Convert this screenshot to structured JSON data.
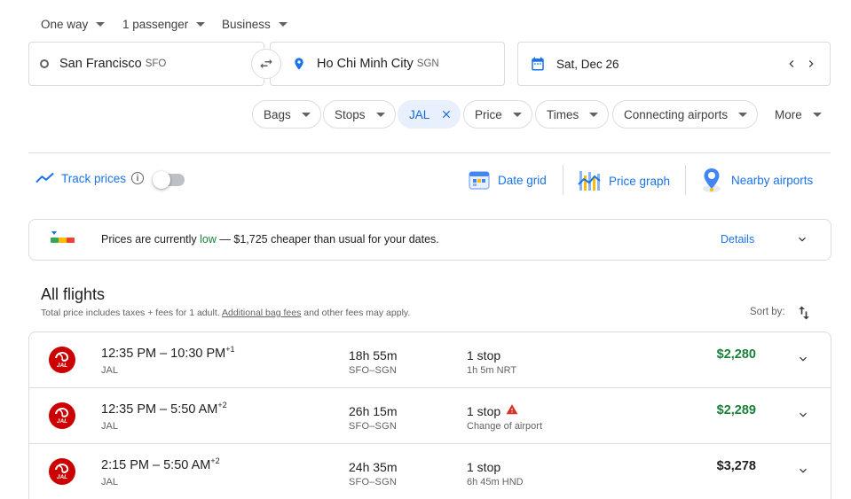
{
  "top_selectors": {
    "trip_type": "One way",
    "passengers": "1 passenger",
    "cabin": "Business"
  },
  "search": {
    "origin_city": "San Francisco",
    "origin_code": "SFO",
    "dest_city": "Ho Chi Minh City",
    "dest_code": "SGN",
    "date": "Sat, Dec 26"
  },
  "filters": [
    "Bags",
    "Stops",
    "JAL",
    "Price",
    "Times",
    "Connecting airports",
    "More"
  ],
  "tools": {
    "track_prices": "Track prices",
    "date_grid": "Date grid",
    "price_graph": "Price graph",
    "nearby_airports": "Nearby airports"
  },
  "insight": {
    "prefix": "Prices are currently ",
    "level": "low",
    "suffix": " — $1,725 cheaper than usual for your dates.",
    "details": "Details"
  },
  "flights_header": {
    "title": "All flights",
    "note_prefix": "Total price includes taxes + fees for 1 adult. ",
    "note_link": "Additional bag fees",
    "note_suffix": " and other fees may apply.",
    "sort_label": "Sort by:"
  },
  "flights": [
    {
      "time": "12:35 PM – 10:30 PM",
      "plus": "+1",
      "airline": "JAL",
      "duration": "18h 55m",
      "route": "SFO–SGN",
      "stops": "1 stop",
      "stop_detail": "1h 5m NRT",
      "price": "$2,280",
      "warning": false
    },
    {
      "time": "12:35 PM – 5:50 AM",
      "plus": "+2",
      "airline": "JAL",
      "duration": "26h 15m",
      "route": "SFO–SGN",
      "stops": "1 stop",
      "stop_detail": "Change of airport",
      "price": "$2,289",
      "warning": true
    },
    {
      "time": "2:15 PM – 5:50 AM",
      "plus": "+2",
      "airline": "JAL",
      "duration": "24h 35m",
      "route": "SFO–SGN",
      "stops": "1 stop",
      "stop_detail": "6h 45m HND",
      "price": "$3,278",
      "warning": false
    }
  ],
  "colors": {
    "accent": "#1a73e8",
    "good_price": "#188038",
    "warning": "#d93025",
    "jal_red": "#cc0000"
  }
}
